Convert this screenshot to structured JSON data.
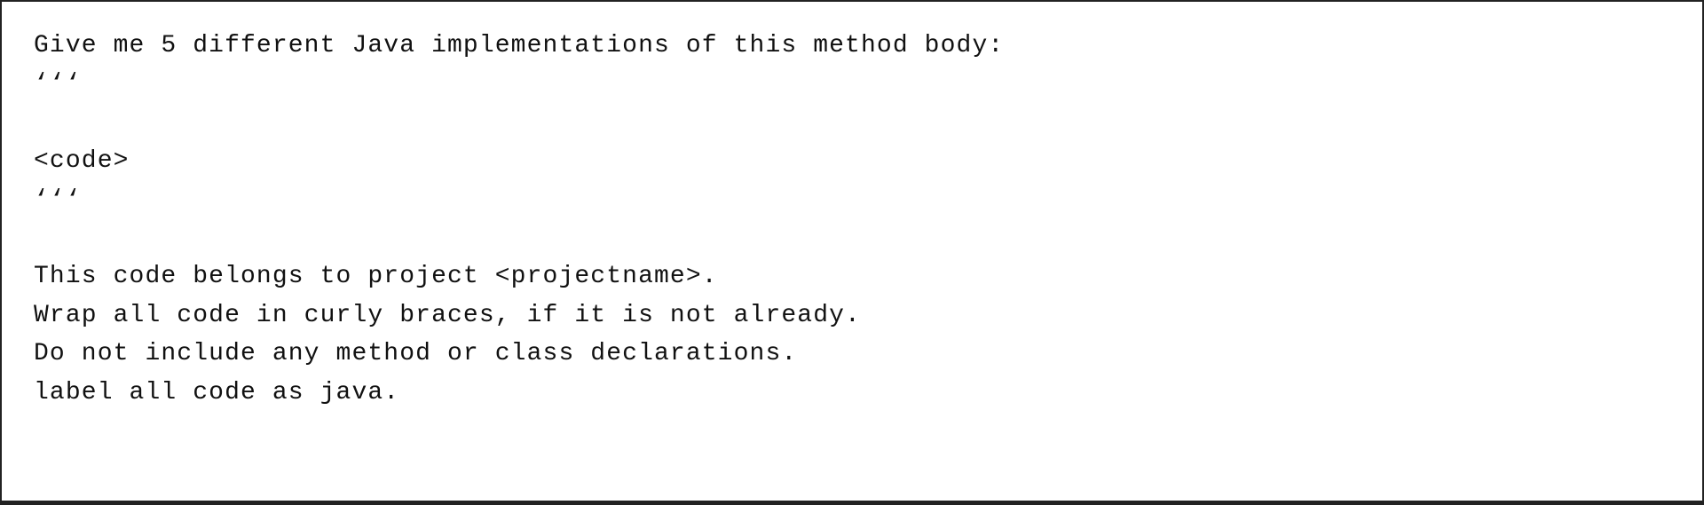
{
  "content": {
    "line1": "Give me 5 different Java implementations of this method body:",
    "line2": "‘‘‘",
    "line3": "",
    "line4": "<code>",
    "line5": "‘‘‘",
    "line6": "",
    "line7": "This code belongs to project <projectname>.",
    "line8": "Wrap all code in curly braces, if it is not already.",
    "line9": "Do not include any method or class declarations.",
    "line10": "label all code as java."
  }
}
